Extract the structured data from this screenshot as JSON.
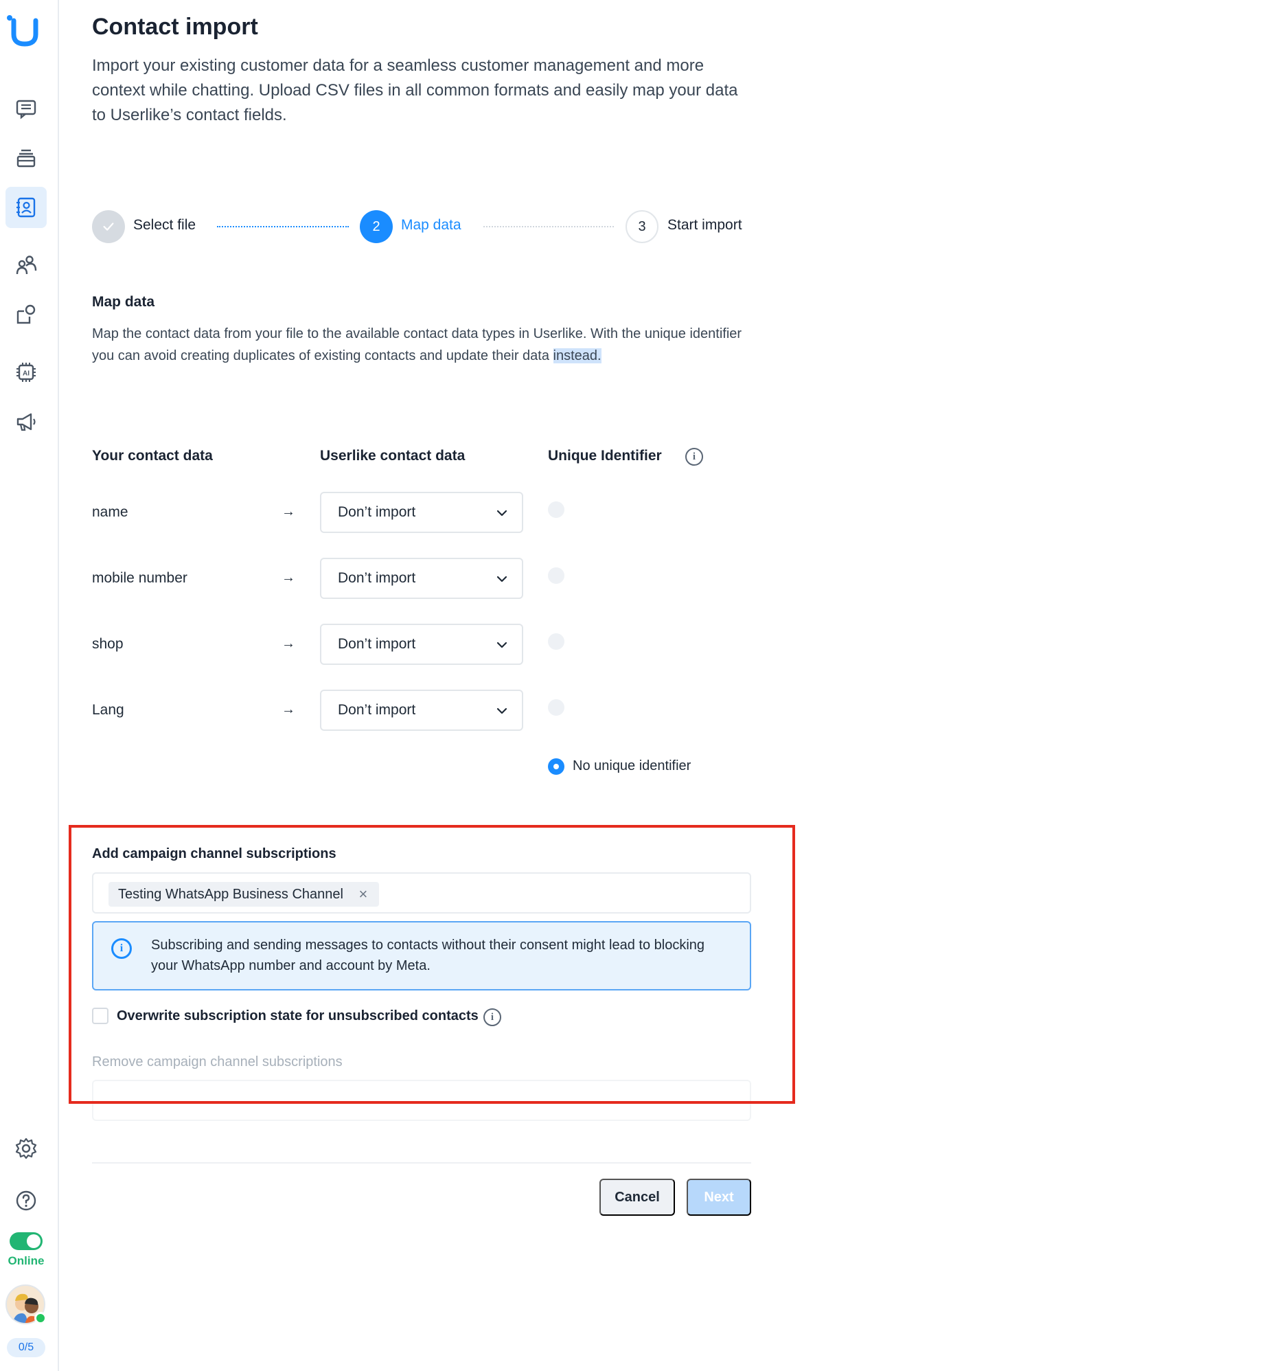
{
  "page": {
    "title": "Contact import",
    "intro": "Import your existing customer data for a seamless customer management and more context while chatting. Upload CSV files in all common formats and easily map your data to Userlike’s contact fields."
  },
  "stepper": {
    "steps": [
      {
        "label": "Select file",
        "state": "done"
      },
      {
        "number": "2",
        "label": "Map data",
        "state": "current"
      },
      {
        "number": "3",
        "label": "Start import",
        "state": "pending"
      }
    ]
  },
  "map_section": {
    "title": "Map data",
    "description_main": "Map the contact data from your file to the available contact data types in Userlike. With the unique identifier you can avoid creating duplicates of existing contacts and update their data ",
    "description_highlighted": "instead."
  },
  "mapping_table": {
    "headers": {
      "your_data": "Your contact data",
      "userlike_data": "Userlike contact data",
      "unique_identifier": "Unique Identifier"
    },
    "rows": [
      {
        "field": "name",
        "selection": "Don’t import"
      },
      {
        "field": "mobile number",
        "selection": "Don’t import"
      },
      {
        "field": "shop",
        "selection": "Don’t import"
      },
      {
        "field": "Lang",
        "selection": "Don’t import"
      }
    ],
    "arrow": "→",
    "no_unique_label": "No unique identifier"
  },
  "subscriptions": {
    "add_title": "Add campaign channel subscriptions",
    "tags": [
      "Testing WhatsApp Business Channel"
    ],
    "remove_tag_symbol": "×",
    "alert_text": "Subscribing and sending messages to contacts without their consent might lead to blocking your WhatsApp number and account by Meta.",
    "overwrite_label": "Overwrite subscription state for unsubscribed contacts",
    "overwrite_checked": false,
    "remove_title": "Remove campaign channel subscriptions"
  },
  "actions": {
    "cancel": "Cancel",
    "next": "Next"
  },
  "sidebar": {
    "items": [
      {
        "icon": "chat-icon"
      },
      {
        "icon": "inbox-stack-icon"
      },
      {
        "icon": "contacts-icon",
        "active": true
      },
      {
        "icon": "team-icon"
      },
      {
        "icon": "integrations-icon"
      },
      {
        "icon": "ai-chip-icon"
      },
      {
        "icon": "megaphone-icon"
      }
    ],
    "bottom": [
      {
        "icon": "gear-icon"
      },
      {
        "icon": "help-icon"
      }
    ],
    "status": "Online",
    "chat_count": "0/5"
  },
  "colors": {
    "accent": "#1a8cff",
    "online": "#22b573",
    "highlight_box": "#e52b1e"
  }
}
